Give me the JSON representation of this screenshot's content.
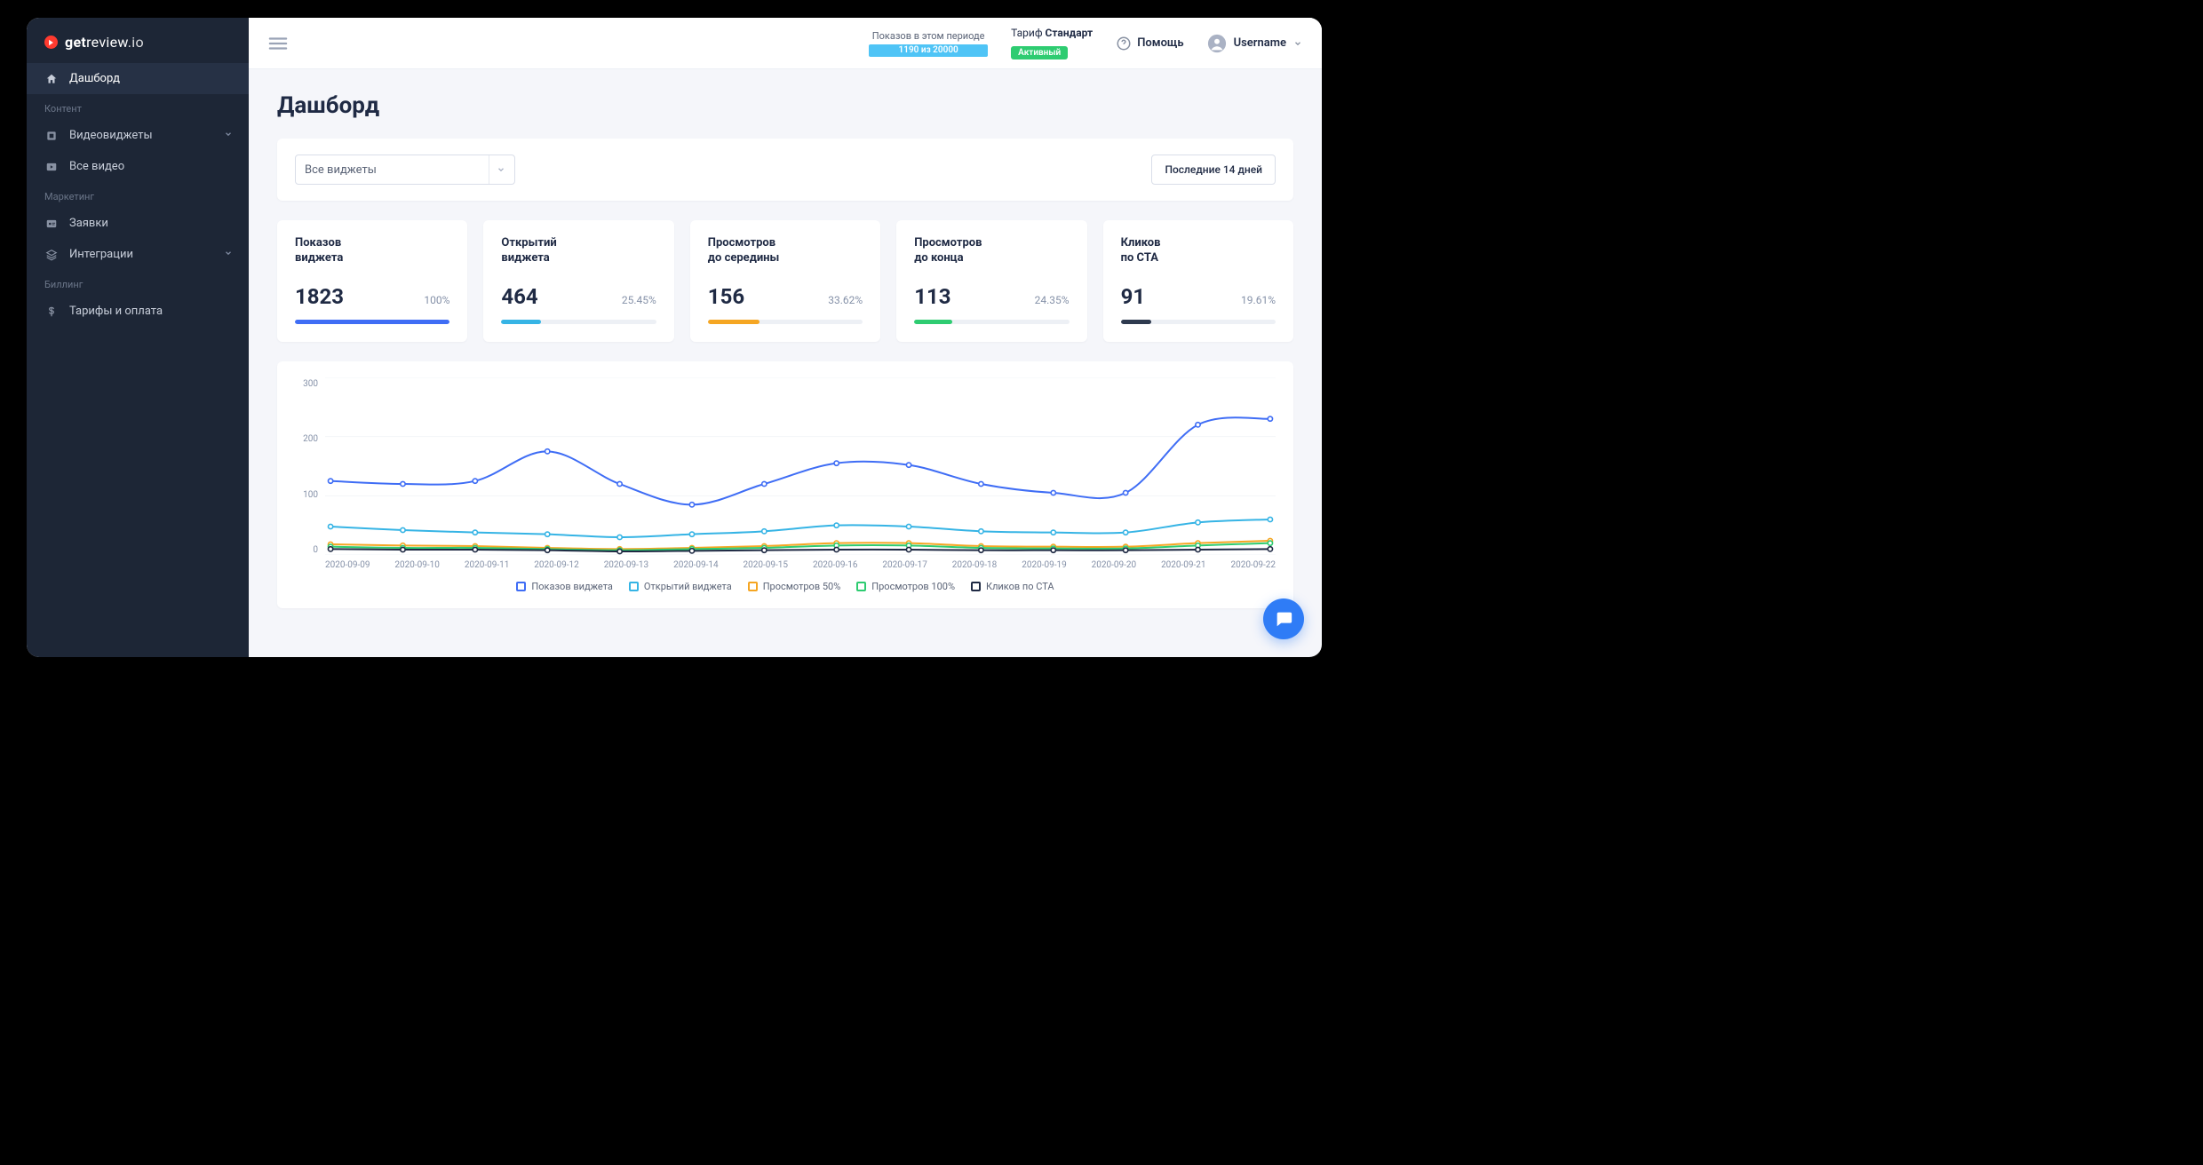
{
  "brand": {
    "name_bold": "get",
    "name_rest": "review",
    "tld": ".io"
  },
  "sidebar": {
    "items": [
      {
        "label": "Дашборд"
      },
      {
        "label": "Видеовиджеты"
      },
      {
        "label": "Все видео"
      },
      {
        "label": "Заявки"
      },
      {
        "label": "Интеграции"
      },
      {
        "label": "Тарифы и оплата"
      }
    ],
    "sections": {
      "content": "Контент",
      "marketing": "Маркетинг",
      "billing": "Биллинг"
    }
  },
  "header": {
    "period_title": "Показов в этом периоде",
    "period_text": "1190 из 20000",
    "tariff_label": "Тариф ",
    "tariff_name": "Стандарт",
    "tariff_badge": "Активный",
    "help": "Помощь",
    "username": "Username"
  },
  "page": {
    "title": "Дашборд"
  },
  "filters": {
    "select_value": "Все виджеты",
    "date_range": "Последние 14 дней"
  },
  "stats": [
    {
      "label": "Показов\nвиджета",
      "value": "1823",
      "pct": "100%",
      "fill": 100,
      "color": "#3f6df5"
    },
    {
      "label": "Открытий\nвиджета",
      "value": "464",
      "pct": "25.45%",
      "fill": 25.45,
      "color": "#36b4e5"
    },
    {
      "label": "Просмотров\nдо середины",
      "value": "156",
      "pct": "33.62%",
      "fill": 33.62,
      "color": "#f5a623"
    },
    {
      "label": "Просмотров\nдо конца",
      "value": "113",
      "pct": "24.35%",
      "fill": 24.35,
      "color": "#2ecc71"
    },
    {
      "label": "Кликов\nпо CTA",
      "value": "91",
      "pct": "19.61%",
      "fill": 19.61,
      "color": "#2e3a4f"
    }
  ],
  "chart_data": {
    "type": "line",
    "ylim": [
      0,
      300
    ],
    "yticks": [
      0,
      100,
      200,
      300
    ],
    "categories": [
      "2020-09-09",
      "2020-09-10",
      "2020-09-11",
      "2020-09-12",
      "2020-09-13",
      "2020-09-14",
      "2020-09-15",
      "2020-09-16",
      "2020-09-17",
      "2020-09-18",
      "2020-09-19",
      "2020-09-20",
      "2020-09-21",
      "2020-09-22"
    ],
    "series": [
      {
        "name": "Показов виджета",
        "color": "#3f6df5",
        "values": [
          125,
          120,
          125,
          175,
          120,
          85,
          120,
          155,
          152,
          120,
          105,
          105,
          220,
          230
        ]
      },
      {
        "name": "Открытий виджета",
        "color": "#36b4e5",
        "values": [
          48,
          42,
          38,
          35,
          30,
          35,
          40,
          50,
          48,
          40,
          38,
          38,
          55,
          60
        ]
      },
      {
        "name": "Просмотров 50%",
        "color": "#f5a623",
        "values": [
          18,
          16,
          15,
          12,
          10,
          12,
          15,
          20,
          20,
          15,
          14,
          14,
          20,
          24
        ]
      },
      {
        "name": "Просмотров 100%",
        "color": "#2ecc71",
        "values": [
          14,
          12,
          12,
          10,
          8,
          10,
          12,
          16,
          16,
          12,
          11,
          11,
          16,
          20
        ]
      },
      {
        "name": "Кликов по CTA",
        "color": "#1f2a44",
        "values": [
          10,
          9,
          9,
          8,
          6,
          7,
          8,
          9,
          9,
          8,
          8,
          8,
          9,
          10
        ]
      }
    ]
  },
  "legend_labels": [
    "Показов виджета",
    "Открытий виджета",
    "Просмотров 50%",
    "Просмотров 100%",
    "Кликов по CTA"
  ],
  "legend_colors": [
    "#3f6df5",
    "#36b4e5",
    "#f5a623",
    "#2ecc71",
    "#1f2a44"
  ]
}
